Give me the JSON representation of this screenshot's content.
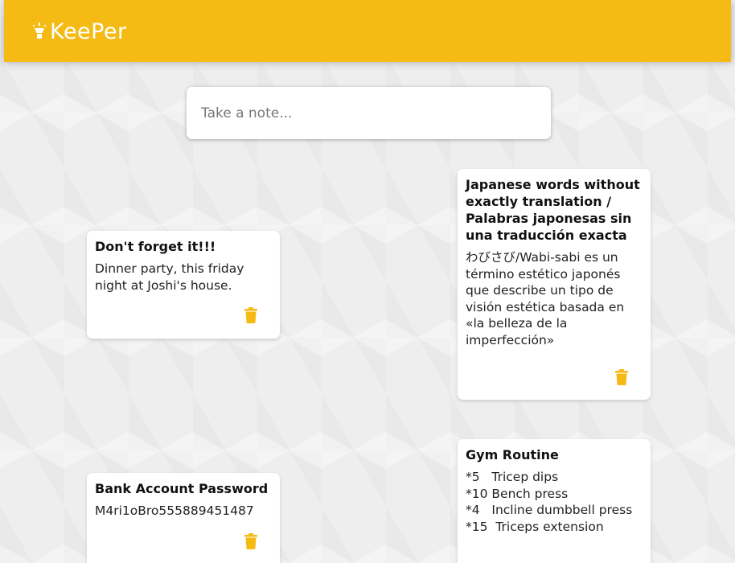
{
  "header": {
    "app_name": "KeePer",
    "brand_color": "#f5ba13",
    "logo_icon": "lightbulb-icon"
  },
  "create_area": {
    "placeholder": "Take a note..."
  },
  "notes": [
    {
      "title": "Don't forget it!!!",
      "content": "Dinner party, this friday night at Joshi's house.",
      "delete_icon": "trash-icon"
    },
    {
      "title": "Japanese words without exactly translation / Palabras japonesas sin una traducción exacta",
      "content": "わびさび/Wabi-sabi es un término estético japonés que describe un tipo de visión estética basada en «la belleza de la imperfección»",
      "delete_icon": "trash-icon"
    },
    {
      "title": "Bank Account Password",
      "content": "M4ri1oBro555889451487",
      "delete_icon": "trash-icon"
    },
    {
      "title": "Gym Routine",
      "content": "*5   Tricep dips\n*10 Bench press\n*4   Incline dumbbell press\n*15  Triceps extension",
      "delete_icon": "trash-icon"
    }
  ]
}
